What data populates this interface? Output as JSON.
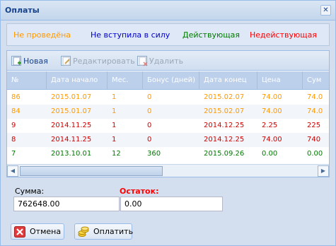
{
  "window": {
    "title": "Оплаты",
    "close_icon": "close-icon"
  },
  "legend": {
    "items": [
      {
        "label": "Не проведёна",
        "color": "#ff9900"
      },
      {
        "label": "Не вступила в силу",
        "color": "#0000cc"
      },
      {
        "label": "Действующая",
        "color": "#007a00"
      },
      {
        "label": "Недействующая",
        "color": "#ff0000"
      }
    ]
  },
  "toolbar": {
    "new_label": "Новая",
    "edit_label": "Редактировать",
    "delete_label": "Удалить"
  },
  "table": {
    "columns": [
      "№",
      "Дата начало",
      "Мес.",
      "Бонус (дней)",
      "Дата конец",
      "Цена",
      "Сум"
    ],
    "rows": [
      {
        "cells": [
          "86",
          "2015.01.07",
          "1",
          "0",
          "2015.02.07",
          "74.00",
          "74.0"
        ],
        "color": "#ff9900"
      },
      {
        "cells": [
          "84",
          "2015.01.07",
          "1",
          "0",
          "2015.02.07",
          "74.00",
          "74.0"
        ],
        "color": "#ff9900"
      },
      {
        "cells": [
          "9",
          "2014.11.25",
          "1",
          "0",
          "2014.12.25",
          "2.25",
          "225"
        ],
        "color": "#cc0000"
      },
      {
        "cells": [
          "8",
          "2014.11.25",
          "1",
          "0",
          "2014.12.25",
          "74.00",
          "740"
        ],
        "color": "#cc0000"
      },
      {
        "cells": [
          "7",
          "2013.10.01",
          "12",
          "360",
          "2015.09.26",
          "0.00",
          "0.00"
        ],
        "color": "#007a00"
      }
    ]
  },
  "form": {
    "sum_label": "Сумма:",
    "sum_value": "762648.00",
    "rest_label": "Остаток:",
    "rest_value": "0.00"
  },
  "buttons": {
    "cancel_label": "Отмена",
    "pay_label": "Оплатить"
  }
}
